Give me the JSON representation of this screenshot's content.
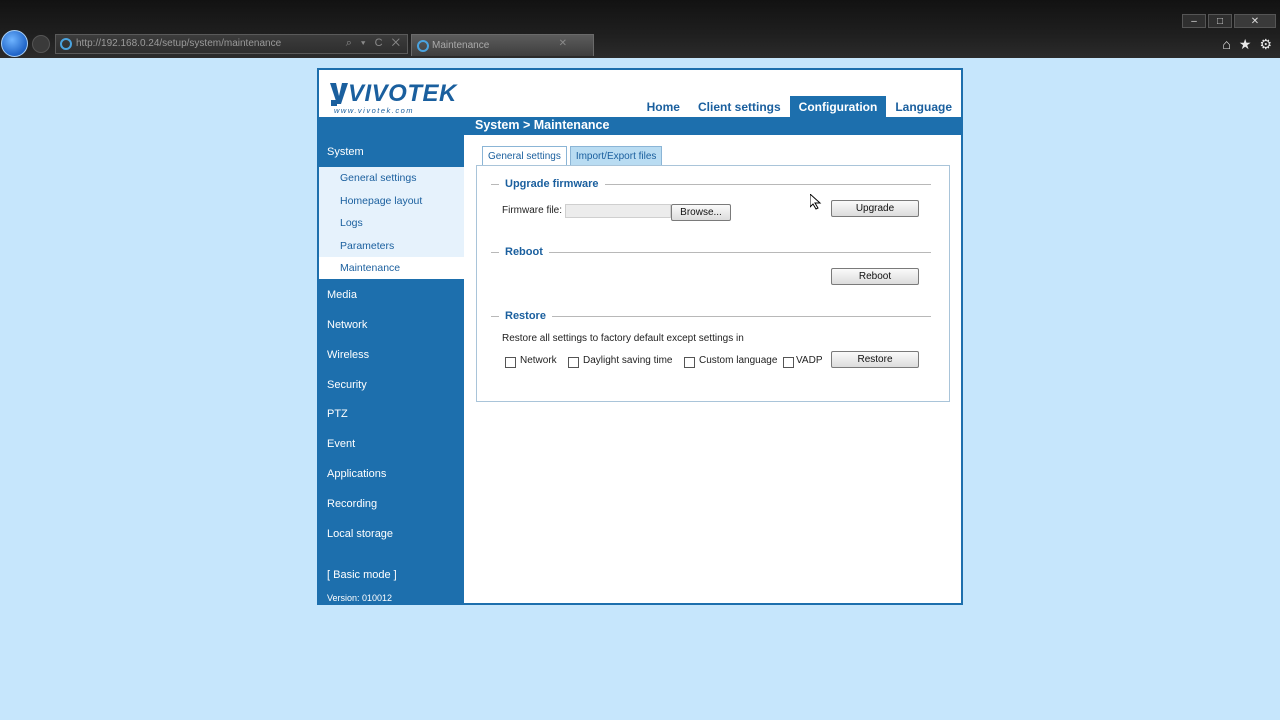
{
  "browser": {
    "address_url": "http://192.168.0.24/setup/system/maintenance",
    "tab_title": "Maintenance",
    "address_tools": "⌕ ▾ C ✕",
    "tab_close": "✕",
    "window_controls": {
      "minimize": "–",
      "maximize": "□",
      "close": "✕"
    },
    "icons": {
      "home": "⌂",
      "favorites": "★",
      "settings": "⚙"
    }
  },
  "header": {
    "logo_text": "VIVOTEK",
    "logo_url": "www.vivotek.com",
    "nav": [
      {
        "label": "Home"
      },
      {
        "label": "Client settings"
      },
      {
        "label": "Configuration"
      },
      {
        "label": "Language"
      }
    ],
    "breadcrumb": "System  > Maintenance"
  },
  "sidebar": {
    "system_label": "System",
    "system_items": [
      {
        "label": "General settings"
      },
      {
        "label": "Homepage layout"
      },
      {
        "label": "Logs"
      },
      {
        "label": "Parameters"
      },
      {
        "label": "Maintenance"
      }
    ],
    "sections": [
      {
        "label": "Media"
      },
      {
        "label": "Network"
      },
      {
        "label": "Wireless"
      },
      {
        "label": "Security"
      },
      {
        "label": "PTZ"
      },
      {
        "label": "Event"
      },
      {
        "label": "Applications"
      },
      {
        "label": "Recording"
      },
      {
        "label": "Local storage"
      }
    ],
    "mode_label": "[ Basic mode ]",
    "version": "Version: 010012"
  },
  "tabs": [
    {
      "label": "General settings"
    },
    {
      "label": "Import/Export files"
    }
  ],
  "upgrade": {
    "legend": "Upgrade firmware",
    "firmware_label": "Firmware file:",
    "browse_label": "Browse...",
    "upgrade_label": "Upgrade"
  },
  "reboot": {
    "legend": "Reboot",
    "reboot_label": "Reboot"
  },
  "restore": {
    "legend": "Restore",
    "description": "Restore all settings to factory default except settings in",
    "options": [
      {
        "label": "Network",
        "checked": false
      },
      {
        "label": "Daylight saving time",
        "checked": false
      },
      {
        "label": "Custom language",
        "checked": false
      },
      {
        "label": "VADP",
        "checked": false
      }
    ],
    "restore_label": "Restore"
  },
  "colors": {
    "primary_blue": "#1d6fad",
    "page_background": "#c6e6fc"
  }
}
